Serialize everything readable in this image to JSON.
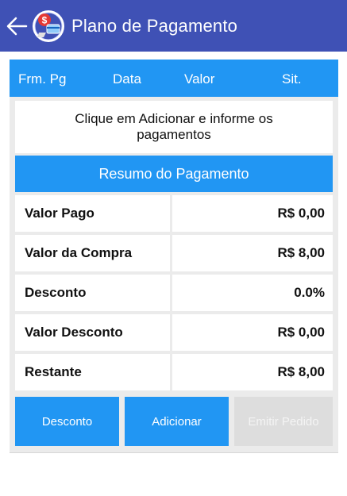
{
  "appbar": {
    "title": "Plano de Pagamento",
    "back_icon": "arrow-left-icon",
    "logo_icon": "payment-logo-icon",
    "color": "#3f51b5"
  },
  "table_header": {
    "columns": [
      "Frm. Pg",
      "Data",
      "Valor",
      "Sit."
    ],
    "color": "#2196f3"
  },
  "info": {
    "message": "Clique em Adicionar e informe os pagamentos"
  },
  "summary": {
    "title": "Resumo do Pagamento",
    "rows": [
      {
        "label": "Valor Pago",
        "value": "R$ 0,00"
      },
      {
        "label": "Valor da Compra",
        "value": "R$ 8,00"
      },
      {
        "label": "Desconto",
        "value": "0.0%"
      },
      {
        "label": "Valor Desconto",
        "value": "R$ 0,00"
      },
      {
        "label": "Restante",
        "value": "R$ 8,00"
      }
    ]
  },
  "buttons": {
    "desconto": "Desconto",
    "adicionar": "Adicionar",
    "emitir": "Emitir Pedido"
  }
}
